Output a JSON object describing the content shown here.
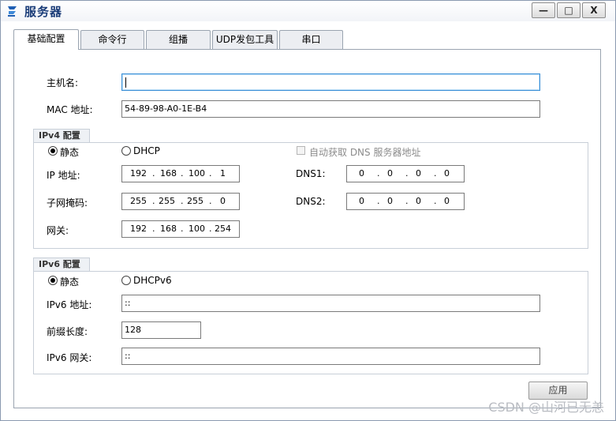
{
  "window": {
    "title": "服务器",
    "minimize_glyph": "—",
    "maximize_glyph": "□",
    "close_glyph": "X"
  },
  "tabs": [
    {
      "label": "基础配置",
      "active": true
    },
    {
      "label": "命令行",
      "active": false
    },
    {
      "label": "组播",
      "active": false
    },
    {
      "label": "UDP发包工具",
      "active": false
    },
    {
      "label": "串口",
      "active": false
    }
  ],
  "basic": {
    "hostname_label": "主机名:",
    "hostname_value": "",
    "mac_label": "MAC 地址:",
    "mac_value": "54-89-98-A0-1E-B4"
  },
  "ipv4": {
    "group_title": "IPv4 配置",
    "static_label": "静态",
    "dhcp_label": "DHCP",
    "auto_dns_label": "自动获取 DNS 服务器地址",
    "ip_label": "IP 地址:",
    "ip_octets": [
      "192",
      "168",
      "100",
      "1"
    ],
    "mask_label": "子网掩码:",
    "mask_octets": [
      "255",
      "255",
      "255",
      "0"
    ],
    "gateway_label": "网关:",
    "gateway_octets": [
      "192",
      "168",
      "100",
      "254"
    ],
    "dns1_label": "DNS1:",
    "dns1_octets": [
      "0",
      "0",
      "0",
      "0"
    ],
    "dns2_label": "DNS2:",
    "dns2_octets": [
      "0",
      "0",
      "0",
      "0"
    ],
    "dot": "."
  },
  "ipv6": {
    "group_title": "IPv6 配置",
    "static_label": "静态",
    "dhcp_label": "DHCPv6",
    "addr_label": "IPv6 地址:",
    "addr_value": "::",
    "prefix_label": "前缀长度:",
    "prefix_value": "128",
    "gateway_label": "IPv6 网关:",
    "gateway_value": "::"
  },
  "apply_label": "应用",
  "watermark": "CSDN @山河已无恙",
  "colors": {
    "title": "#1a3c78",
    "focus_border": "#3a8fd6"
  }
}
